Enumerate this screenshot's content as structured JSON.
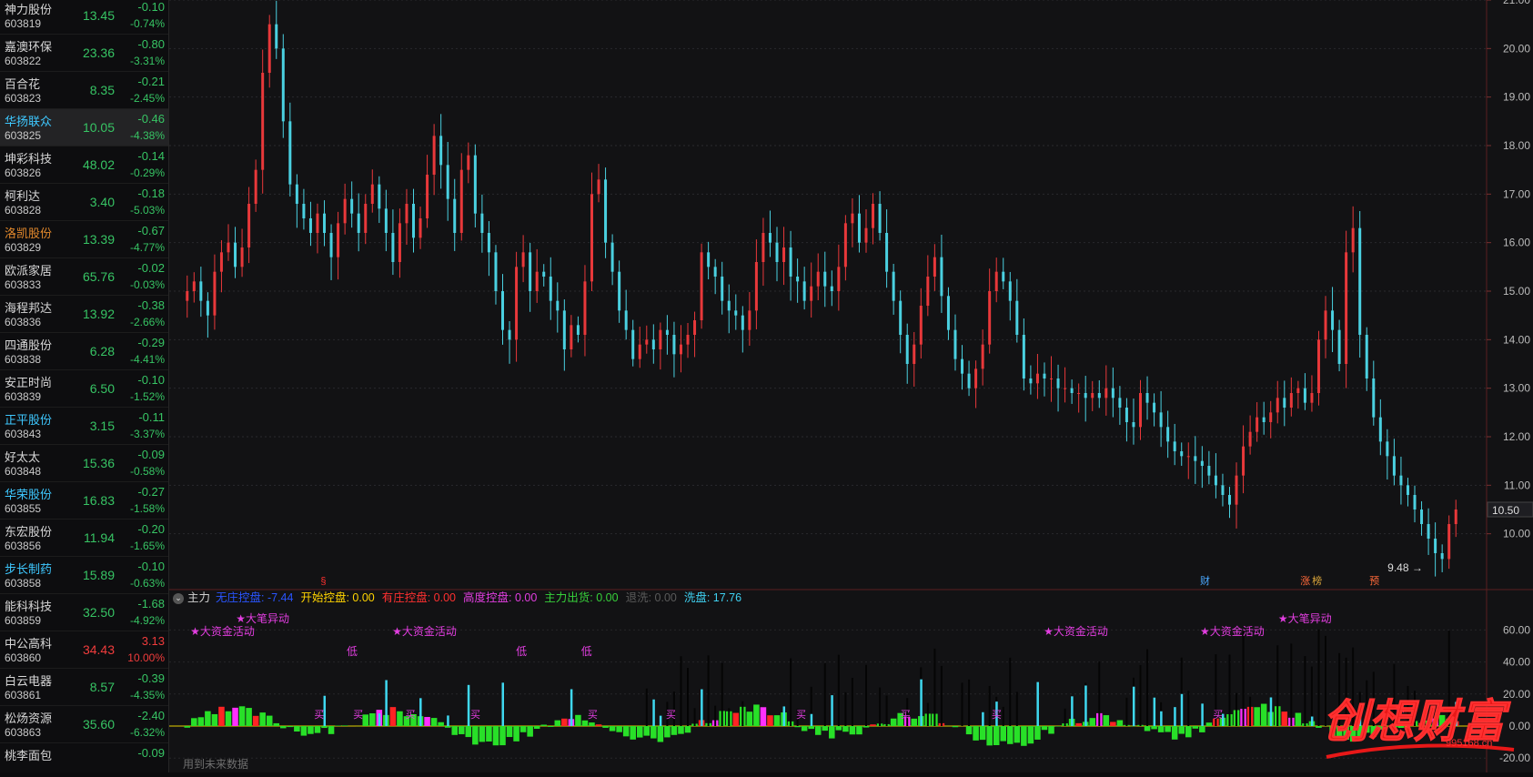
{
  "stock_list": [
    {
      "name": "神力股份",
      "code": "603819",
      "price": "13.45",
      "change": "-0.10",
      "pct": "-0.74%",
      "name_color": "#d8d8d8",
      "dir": "down"
    },
    {
      "name": "嘉澳环保",
      "code": "603822",
      "price": "23.36",
      "change": "-0.80",
      "pct": "-3.31%",
      "name_color": "#d8d8d8",
      "dir": "down"
    },
    {
      "name": "百合花",
      "code": "603823",
      "price": "8.35",
      "change": "-0.21",
      "pct": "-2.45%",
      "name_color": "#d8d8d8",
      "dir": "down"
    },
    {
      "name": "华扬联众",
      "code": "603825",
      "price": "10.05",
      "change": "-0.46",
      "pct": "-4.38%",
      "name_color": "#3ec8ff",
      "dir": "down",
      "selected": true
    },
    {
      "name": "坤彩科技",
      "code": "603826",
      "price": "48.02",
      "change": "-0.14",
      "pct": "-0.29%",
      "name_color": "#d8d8d8",
      "dir": "down"
    },
    {
      "name": "柯利达",
      "code": "603828",
      "price": "3.40",
      "change": "-0.18",
      "pct": "-5.03%",
      "name_color": "#d8d8d8",
      "dir": "down"
    },
    {
      "name": "洛凯股份",
      "code": "603829",
      "price": "13.39",
      "change": "-0.67",
      "pct": "-4.77%",
      "name_color": "#e3892c",
      "dir": "down"
    },
    {
      "name": "欧派家居",
      "code": "603833",
      "price": "65.76",
      "change": "-0.02",
      "pct": "-0.03%",
      "name_color": "#d8d8d8",
      "dir": "down"
    },
    {
      "name": "海程邦达",
      "code": "603836",
      "price": "13.92",
      "change": "-0.38",
      "pct": "-2.66%",
      "name_color": "#d8d8d8",
      "dir": "down"
    },
    {
      "name": "四通股份",
      "code": "603838",
      "price": "6.28",
      "change": "-0.29",
      "pct": "-4.41%",
      "name_color": "#d8d8d8",
      "dir": "down"
    },
    {
      "name": "安正时尚",
      "code": "603839",
      "price": "6.50",
      "change": "-0.10",
      "pct": "-1.52%",
      "name_color": "#d8d8d8",
      "dir": "down"
    },
    {
      "name": "正平股份",
      "code": "603843",
      "price": "3.15",
      "change": "-0.11",
      "pct": "-3.37%",
      "name_color": "#3ec8ff",
      "dir": "down"
    },
    {
      "name": "好太太",
      "code": "603848",
      "price": "15.36",
      "change": "-0.09",
      "pct": "-0.58%",
      "name_color": "#d8d8d8",
      "dir": "down"
    },
    {
      "name": "华荣股份",
      "code": "603855",
      "price": "16.83",
      "change": "-0.27",
      "pct": "-1.58%",
      "name_color": "#3ec8ff",
      "dir": "down"
    },
    {
      "name": "东宏股份",
      "code": "603856",
      "price": "11.94",
      "change": "-0.20",
      "pct": "-1.65%",
      "name_color": "#d8d8d8",
      "dir": "down"
    },
    {
      "name": "步长制药",
      "code": "603858",
      "price": "15.89",
      "change": "-0.10",
      "pct": "-0.63%",
      "name_color": "#3ec8ff",
      "dir": "down"
    },
    {
      "name": "能科科技",
      "code": "603859",
      "price": "32.50",
      "change": "-1.68",
      "pct": "-4.92%",
      "name_color": "#d8d8d8",
      "dir": "down"
    },
    {
      "name": "中公高科",
      "code": "603860",
      "price": "34.43",
      "change": "3.13",
      "pct": "10.00%",
      "name_color": "#d8d8d8",
      "dir": "up"
    },
    {
      "name": "白云电器",
      "code": "603861",
      "price": "8.57",
      "change": "-0.39",
      "pct": "-4.35%",
      "name_color": "#d8d8d8",
      "dir": "down"
    },
    {
      "name": "松炀资源",
      "code": "603863",
      "price": "35.60",
      "change": "-2.40",
      "pct": "-6.32%",
      "name_color": "#d8d8d8",
      "dir": "down"
    },
    {
      "name": "桃李面包",
      "code": "",
      "price": "",
      "change": "-0.09",
      "pct": "",
      "name_color": "#d8d8d8",
      "dir": "down"
    }
  ],
  "colors": {
    "up": "#f03c3c",
    "down": "#37c464",
    "flat": "#c8c8c8",
    "candle_up": "#e8383a",
    "candle_down": "#4ad0e0"
  },
  "chart_data": [
    {
      "type": "candlestick",
      "title": "",
      "ylim": [
        9.0,
        21.0
      ],
      "yticks": [
        "21.00",
        "20.00",
        "19.00",
        "18.00",
        "17.00",
        "16.00",
        "15.00",
        "14.00",
        "13.00",
        "12.00",
        "11.00",
        "10.00"
      ],
      "current_price_tag": "10.50",
      "low_annotation": "9.48",
      "closes": [
        15.0,
        15.2,
        14.8,
        14.5,
        15.4,
        15.8,
        16.0,
        15.5,
        15.9,
        16.8,
        17.5,
        19.5,
        20.5,
        20.0,
        18.5,
        17.2,
        16.8,
        16.5,
        16.2,
        16.6,
        16.2,
        15.7,
        16.4,
        16.9,
        16.6,
        16.2,
        16.8,
        17.2,
        16.7,
        16.2,
        15.6,
        16.4,
        16.8,
        16.1,
        16.5,
        17.4,
        18.2,
        17.6,
        16.9,
        16.2,
        17.5,
        17.8,
        16.6,
        16.2,
        15.8,
        15.0,
        14.2,
        14.0,
        15.5,
        15.8,
        15.0,
        15.4,
        15.3,
        14.8,
        14.6,
        13.8,
        14.3,
        14.1,
        15.2,
        17.0,
        17.3,
        16.0,
        15.4,
        14.6,
        14.2,
        13.6,
        13.9,
        14.0,
        13.8,
        14.2,
        14.1,
        13.7,
        13.9,
        14.1,
        14.4,
        15.8,
        15.5,
        15.3,
        14.8,
        14.6,
        14.5,
        14.2,
        14.6,
        15.6,
        16.2,
        16.0,
        15.6,
        15.9,
        15.3,
        15.2,
        14.8,
        15.1,
        15.4,
        15.1,
        15.0,
        15.5,
        16.4,
        16.6,
        16.0,
        16.3,
        16.8,
        16.2,
        15.4,
        14.8,
        14.1,
        13.5,
        13.9,
        14.7,
        15.3,
        15.7,
        14.9,
        14.2,
        13.6,
        13.3,
        13.0,
        13.4,
        13.9,
        15.0,
        15.4,
        15.2,
        14.8,
        14.1,
        13.2,
        13.1,
        13.3,
        13.2,
        13.2,
        13.0,
        13.0,
        12.9,
        12.9,
        12.8,
        12.9,
        12.8,
        13.0,
        12.8,
        12.6,
        12.3,
        12.2,
        12.9,
        12.7,
        12.5,
        12.2,
        11.9,
        11.7,
        11.6,
        11.6,
        11.5,
        11.4,
        11.2,
        11.0,
        10.8,
        10.6,
        11.2,
        11.8,
        12.1,
        12.4,
        12.3,
        12.5,
        12.8,
        12.6,
        12.9,
        13.0,
        12.7,
        12.9,
        14.0,
        14.6,
        14.2,
        13.5,
        15.8,
        16.3,
        14.1,
        13.2,
        12.4,
        11.9,
        11.6,
        11.2,
        11.0,
        10.8,
        10.5,
        10.2,
        9.9,
        9.6,
        9.48,
        10.2,
        10.5
      ],
      "below_markers": [
        "§",
        "财",
        "涨",
        "榜",
        "预"
      ]
    },
    {
      "type": "bar",
      "name": "主力",
      "ylim": [
        -25,
        75
      ],
      "yticks": [
        "60.00",
        "40.00",
        "20.00",
        "0.00",
        "-20.00"
      ],
      "legend": [
        {
          "label": "无庄控盘:",
          "value": "-7.44",
          "color": "#2a55ff"
        },
        {
          "label": "开始控盘:",
          "value": "0.00",
          "color": "#ffd400"
        },
        {
          "label": "有庄控盘:",
          "value": "0.00",
          "color": "#ff3030"
        },
        {
          "label": "高度控盘:",
          "value": "0.00",
          "color": "#e23ee0"
        },
        {
          "label": "主力出货:",
          "value": "0.00",
          "color": "#37d03a"
        },
        {
          "label": "退洗:",
          "value": "0.00",
          "color": "#5a5a5a"
        },
        {
          "label": "洗盘:",
          "value": "17.76",
          "color": "#3fd0f0"
        }
      ],
      "annotations": [
        "★大资金活动",
        "★大笔异动",
        "低",
        "买"
      ],
      "footer": "用到未来数据"
    }
  ],
  "watermark": {
    "text": "创想财富",
    "sub": "995168.cn"
  }
}
